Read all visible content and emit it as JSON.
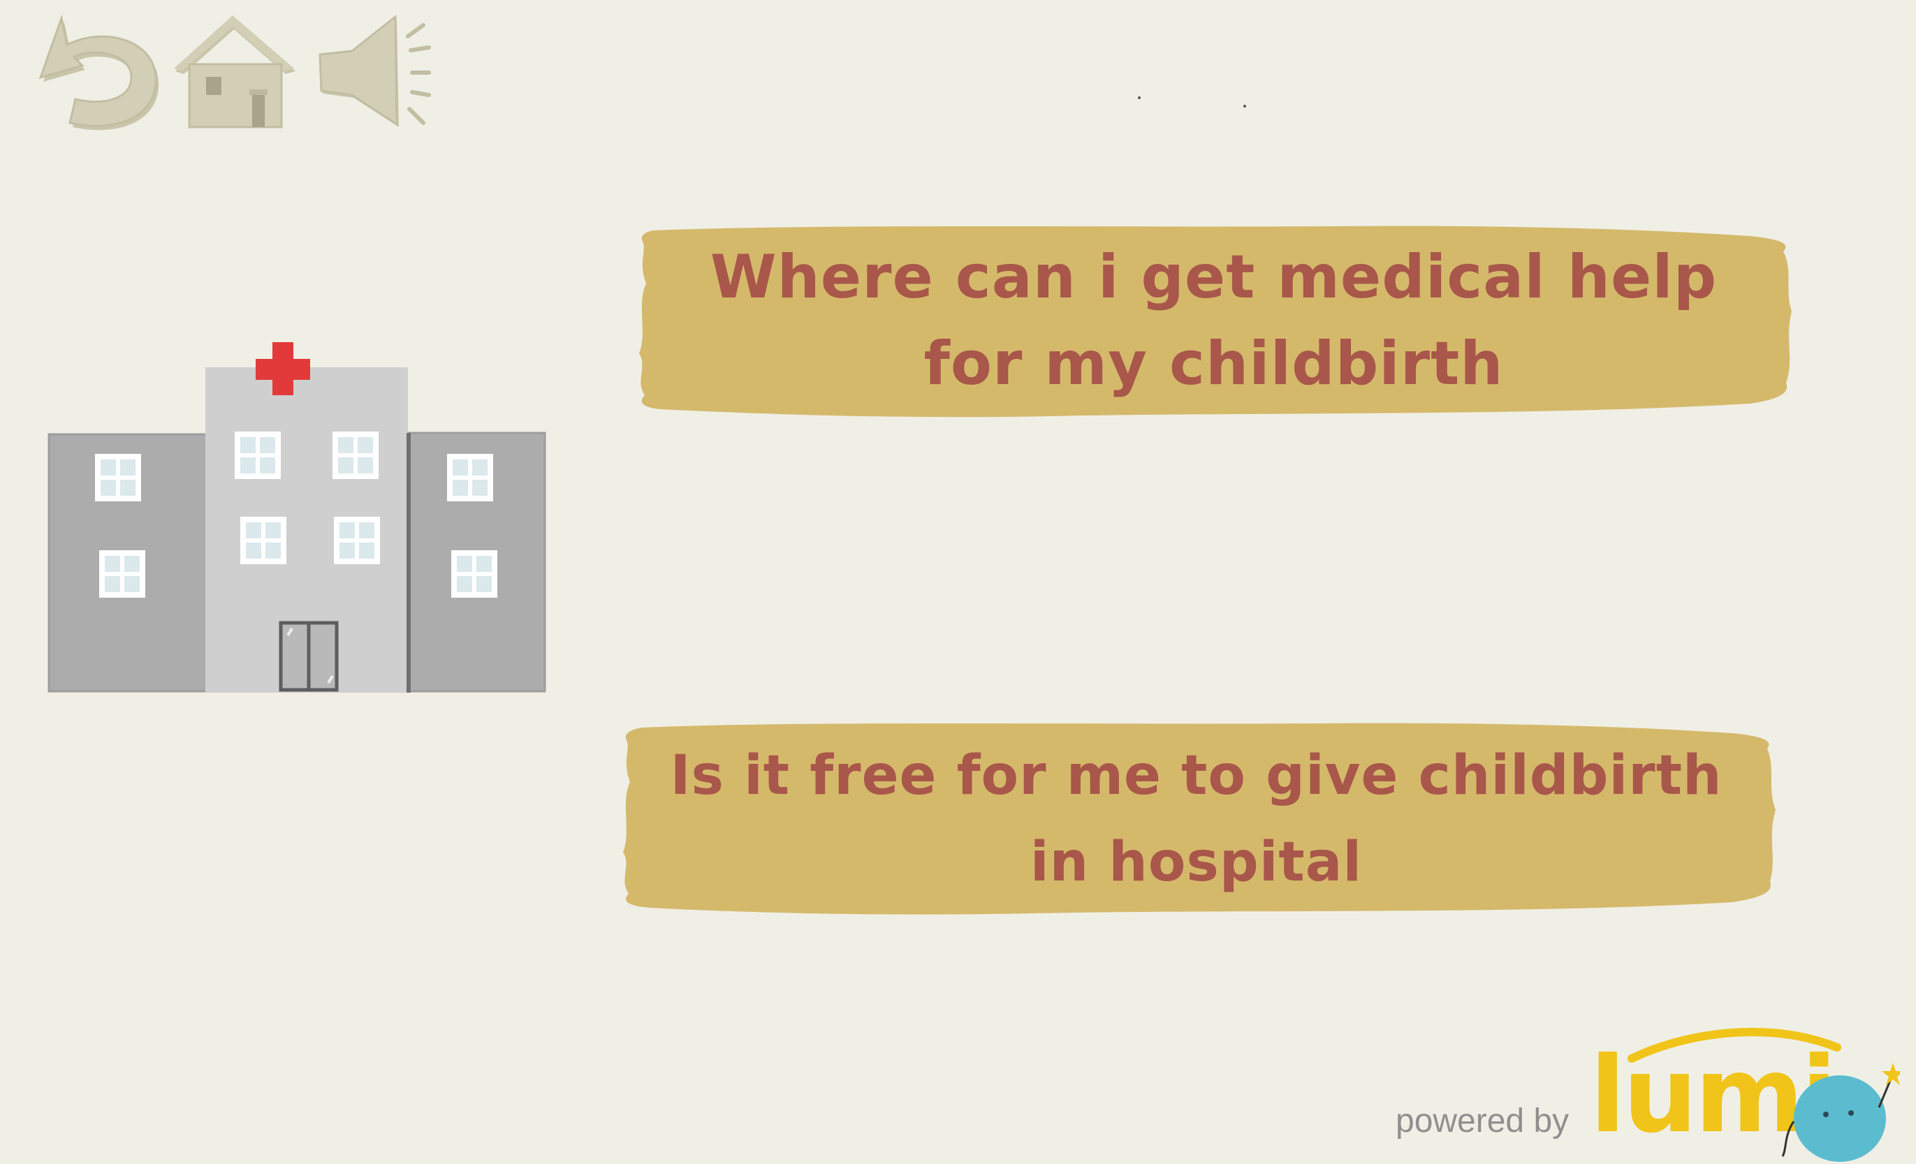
{
  "toolbar": {
    "back_icon": "undo-arrow-icon",
    "home_icon": "house-icon",
    "sound_icon": "speaker-icon"
  },
  "illustration": {
    "icon": "hospital-building-icon"
  },
  "choices": [
    {
      "label": "Where can i get medical help for my childbirth"
    },
    {
      "label": "Is it free for me to give childbirth in hospital"
    }
  ],
  "footer": {
    "powered_by": "powered by",
    "brand": "lumi"
  },
  "colors": {
    "background": "#f0efe6",
    "button_fill": "#d5b96b",
    "button_text": "#a8574a",
    "nav_icon": "#d0ccb2",
    "brand_yellow": "#f0c419",
    "brand_blue": "#5bbccf"
  }
}
